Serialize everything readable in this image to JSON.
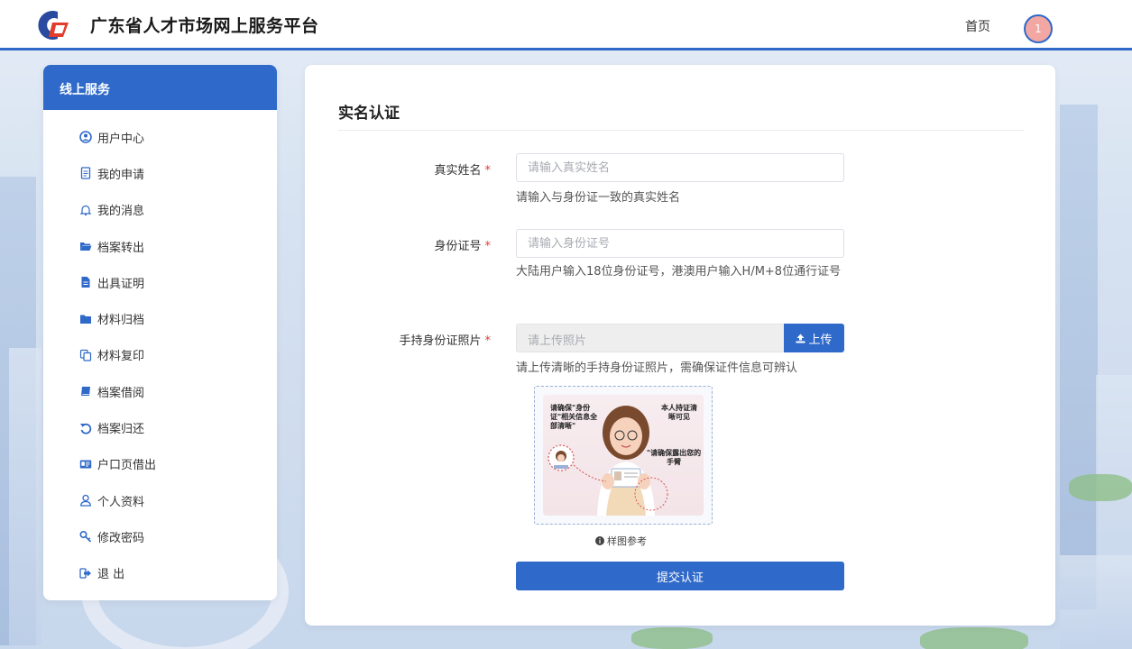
{
  "header": {
    "site_title": "广东省人才市场网上服务平台",
    "home_link": "首页",
    "avatar_text": "1",
    "brand_color": "#2f69c9"
  },
  "sidebar": {
    "title": "线上服务",
    "items": [
      {
        "label": "用户中心",
        "icon": "user-circle-icon"
      },
      {
        "label": "我的申请",
        "icon": "document-icon"
      },
      {
        "label": "我的消息",
        "icon": "bell-icon"
      },
      {
        "label": "档案转出",
        "icon": "folder-open-icon"
      },
      {
        "label": "出具证明",
        "icon": "file-icon"
      },
      {
        "label": "材料归档",
        "icon": "folder-icon"
      },
      {
        "label": "材料复印",
        "icon": "copy-icon"
      },
      {
        "label": "档案借阅",
        "icon": "book-icon"
      },
      {
        "label": "档案归还",
        "icon": "undo-icon"
      },
      {
        "label": "户口页借出",
        "icon": "id-card-icon"
      },
      {
        "label": "个人资料",
        "icon": "person-icon"
      },
      {
        "label": "修改密码",
        "icon": "key-icon"
      },
      {
        "label": "退 出",
        "icon": "sign-out-icon"
      }
    ]
  },
  "form": {
    "title": "实名认证",
    "name": {
      "label": "真实姓名",
      "required_mark": "*",
      "placeholder": "请输入真实姓名",
      "value": "",
      "hint": "请输入与身份证一致的真实姓名"
    },
    "id_number": {
      "label": "身份证号",
      "required_mark": "*",
      "placeholder": "请输入身份证号",
      "value": "",
      "hint": "大陆用户输入18位身份证号，港澳用户输入H/M+8位通行证号"
    },
    "photo": {
      "label": "手持身份证照片",
      "required_mark": "*",
      "placeholder": "请上传照片",
      "upload_label": "上传",
      "hint": "请上传清晰的手持身份证照片，需确保证件信息可辨认",
      "sample_texts": {
        "top_left": "请确保\"身份证\"相关信息全部清晰\"",
        "top_right": "本人持证清晰可见",
        "mid_right": "\"请确保露出您的手臂"
      },
      "sample_caption": "样图参考"
    },
    "submit_label": "提交认证"
  }
}
